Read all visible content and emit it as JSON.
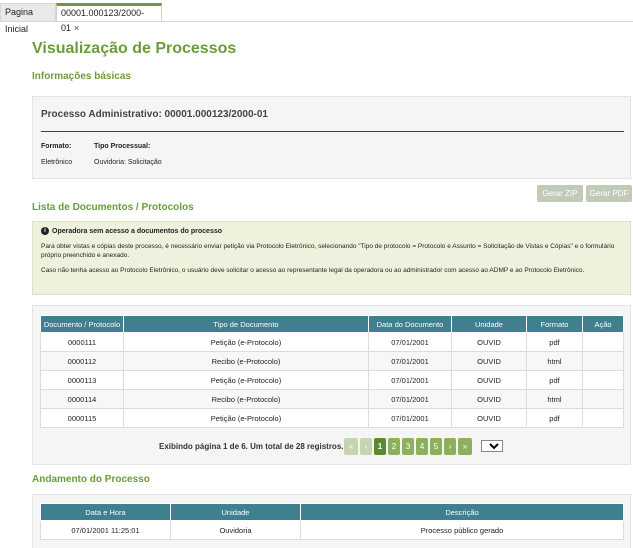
{
  "tabs": [
    {
      "label": "Pagina Inicial",
      "active": false
    },
    {
      "label": "00001.000123/2000-01",
      "active": true,
      "close": "×"
    }
  ],
  "page": {
    "title": "Visualização de Processos"
  },
  "basic_info": {
    "section_title": "Informações básicas",
    "process_heading": "Processo Administrativo: 00001.000123/2000-01",
    "format_label": "Formato:",
    "format_value": "Eletrônico",
    "type_label": "Tipo Processual:",
    "type_value": "Ouvidoria: Solicitação"
  },
  "buttons": {
    "zip": "Gerar ZIP",
    "pdf": "Gerar PDF"
  },
  "documents": {
    "section_title": "Lista de Documentos / Protocolos",
    "notice_title": "Operadora sem acesso a documentos do processo",
    "notice_p1": "Para obter vistas e cópias deste processo, é necessário enviar petição via Protocolo Eletrônico, selecionando \"Tipo de protocolo = Protocolo e Assunto = Solicitação de Vistas e Cópias\" e o formulário próprio preenchido e anexado.",
    "notice_p2": "Caso não tenha acesso ao Protocolo Eletrônico, o usuário deve solicitar o acesso ao representante legal da operadora ou ao administrador com acesso ao ADMP e ao Protocolo Eletrônico.",
    "columns": [
      "Documento / Protocolo",
      "Tipo de Documento",
      "Data do Documento",
      "Unidade",
      "Formato",
      "Ação"
    ],
    "rows": [
      [
        "0000111",
        "Petição (e-Protocolo)",
        "07/01/2001",
        "OUVID",
        "pdf",
        ""
      ],
      [
        "0000112",
        "Recibo (e-Protocolo)",
        "07/01/2001",
        "OUVID",
        "html",
        ""
      ],
      [
        "0000113",
        "Petição (e-Protocolo)",
        "07/01/2001",
        "OUVID",
        "pdf",
        ""
      ],
      [
        "0000114",
        "Recibo (e-Protocolo)",
        "07/01/2001",
        "OUVID",
        "html",
        ""
      ],
      [
        "0000115",
        "Petição (e-Protocolo)",
        "07/01/2001",
        "OUVID",
        "pdf",
        ""
      ]
    ],
    "pagination": {
      "text": "Exibindo página 1 de 6. Um total de 28 registros.",
      "first": "«",
      "prev": "‹",
      "pages": [
        "1",
        "2",
        "3",
        "4",
        "5"
      ],
      "current": "1",
      "next": "›",
      "last": "»",
      "page_size": "5"
    }
  },
  "progress": {
    "section_title": "Andamento do Processo",
    "columns": [
      "Data e Hora",
      "Unidade",
      "Descrição"
    ],
    "rows": [
      [
        "07/01/2001 11:25:01",
        "Ouvidoria",
        "Processo público gerado"
      ]
    ]
  }
}
